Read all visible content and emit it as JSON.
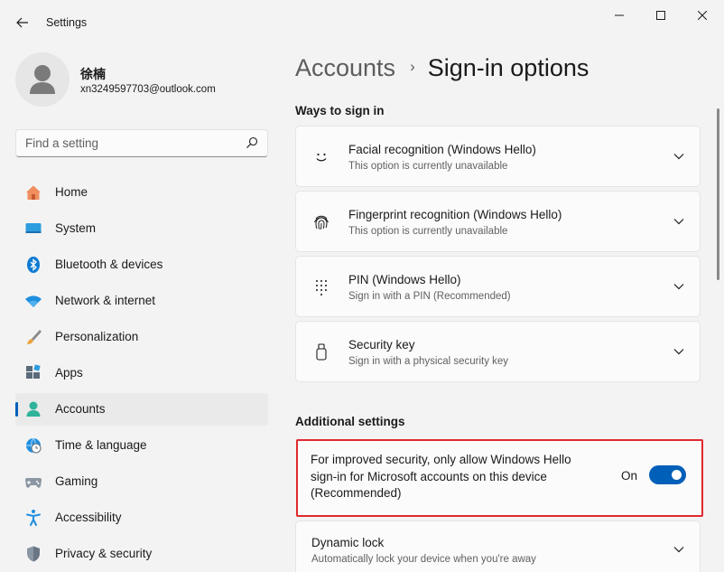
{
  "window": {
    "title": "Settings",
    "back_icon": "back-arrow-icon",
    "controls": [
      "minimize-icon",
      "maximize-icon",
      "close-icon"
    ]
  },
  "user": {
    "name": "徐楠",
    "email": "xn3249597703@outlook.com"
  },
  "search": {
    "placeholder": "Find a setting",
    "value": ""
  },
  "nav": {
    "items": [
      {
        "label": "Home",
        "icon": "home-icon",
        "selected": false
      },
      {
        "label": "System",
        "icon": "monitor-icon",
        "selected": false
      },
      {
        "label": "Bluetooth & devices",
        "icon": "bluetooth-icon",
        "selected": false
      },
      {
        "label": "Network & internet",
        "icon": "wifi-icon",
        "selected": false
      },
      {
        "label": "Personalization",
        "icon": "brush-icon",
        "selected": false
      },
      {
        "label": "Apps",
        "icon": "apps-icon",
        "selected": false
      },
      {
        "label": "Accounts",
        "icon": "person-icon",
        "selected": true
      },
      {
        "label": "Time & language",
        "icon": "globe-clock-icon",
        "selected": false
      },
      {
        "label": "Gaming",
        "icon": "gamepad-icon",
        "selected": false
      },
      {
        "label": "Accessibility",
        "icon": "accessibility-icon",
        "selected": false
      },
      {
        "label": "Privacy & security",
        "icon": "shield-icon",
        "selected": false
      }
    ]
  },
  "breadcrumb": {
    "parent": "Accounts",
    "separator": "›",
    "current": "Sign-in options"
  },
  "ways_to_sign_in": {
    "title": "Ways to sign in",
    "items": [
      {
        "title": "Facial recognition (Windows Hello)",
        "subtitle": "This option is currently unavailable",
        "icon": "face-icon"
      },
      {
        "title": "Fingerprint recognition (Windows Hello)",
        "subtitle": "This option is currently unavailable",
        "icon": "fingerprint-icon"
      },
      {
        "title": "PIN (Windows Hello)",
        "subtitle": "Sign in with a PIN (Recommended)",
        "icon": "pin-keypad-icon"
      },
      {
        "title": "Security key",
        "subtitle": "Sign in with a physical security key",
        "icon": "usb-key-icon"
      }
    ]
  },
  "additional_settings": {
    "title": "Additional settings",
    "hello_only": {
      "text": "For improved security, only allow Windows Hello sign-in for Microsoft accounts on this device (Recommended)",
      "toggle_label": "On",
      "toggle_state": true
    },
    "dynamic_lock": {
      "title": "Dynamic lock",
      "subtitle": "Automatically lock your device when you're away"
    }
  },
  "colors": {
    "accent": "#005fb8",
    "highlight_border": "#e0292c",
    "background": "#f3f3f3",
    "card": "#fbfbfb"
  }
}
